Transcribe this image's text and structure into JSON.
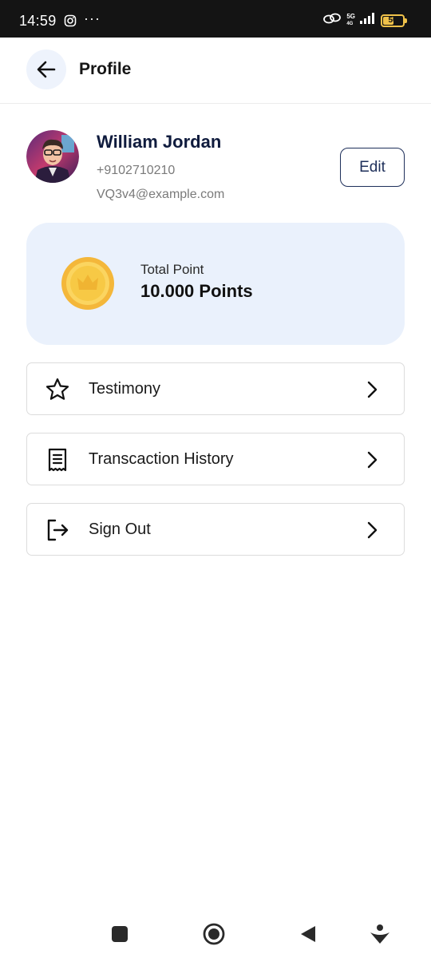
{
  "status_bar": {
    "time": "14:59",
    "dots": "···",
    "network_top": "5G",
    "network_bottom": "4G",
    "battery": "50",
    "battery_level": 0.5
  },
  "header": {
    "title": "Profile",
    "back_icon": "arrow-left-icon"
  },
  "profile": {
    "name": "William Jordan",
    "phone": "+9102710210",
    "email": "VQ3v4@example.com",
    "edit_label": "Edit"
  },
  "points": {
    "label": "Total Point",
    "value": "10.000 Points",
    "icon": "crown-coin-icon"
  },
  "menu": {
    "items": [
      {
        "label": "Testimony",
        "icon": "star-icon"
      },
      {
        "label": "Transcaction History",
        "icon": "receipt-icon"
      },
      {
        "label": "Sign Out",
        "icon": "sign-out-icon"
      }
    ]
  },
  "colors": {
    "accent_navy": "#0f1b3d",
    "card_bg": "#eaf1fc",
    "coin": "#f7c945"
  }
}
